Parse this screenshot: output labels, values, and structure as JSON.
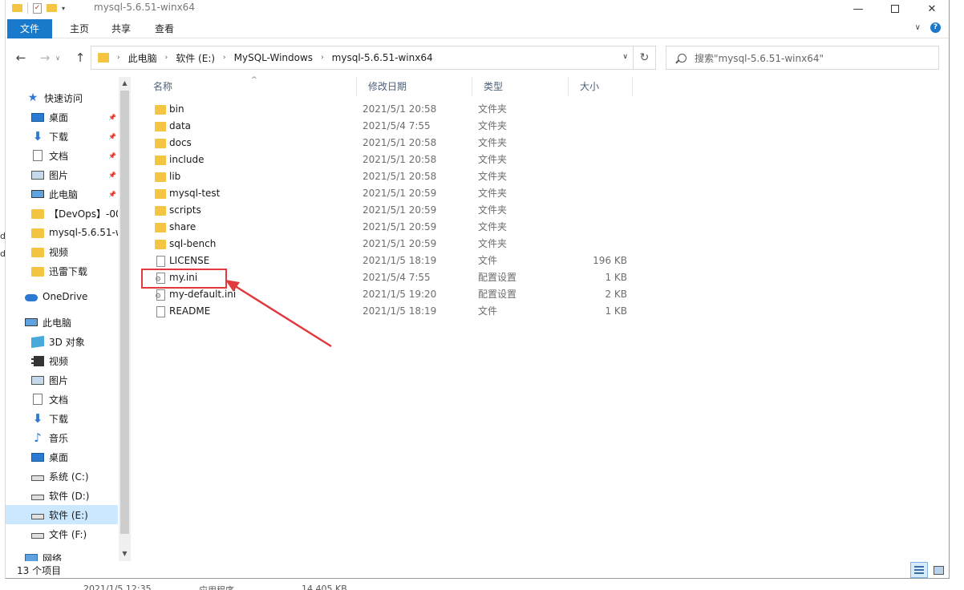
{
  "window": {
    "title": "mysql-5.6.51-winx64",
    "min_label": "—",
    "max_label": "",
    "close_label": "✕"
  },
  "ribbon": {
    "tabs": [
      "文件",
      "主页",
      "共享",
      "查看"
    ],
    "help_label": "?"
  },
  "address": {
    "crumbs": [
      "此电脑",
      "软件 (E:)",
      "MySQL-Windows",
      "mysql-5.6.51-winx64"
    ],
    "search_placeholder": "搜索\"mysql-5.6.51-winx64\""
  },
  "nav_pane": {
    "items": [
      {
        "label": "快速访问",
        "icon": "star-icon",
        "pinned": false
      },
      {
        "label": "桌面",
        "icon": "desktop-icon",
        "pinned": true
      },
      {
        "label": "下载",
        "icon": "download-icon",
        "pinned": true
      },
      {
        "label": "文档",
        "icon": "document-icon",
        "pinned": true
      },
      {
        "label": "图片",
        "icon": "picture-icon",
        "pinned": true
      },
      {
        "label": "此电脑",
        "icon": "computer-icon",
        "pinned": true
      },
      {
        "label": "【DevOps】-00",
        "icon": "folder-icon",
        "pinned": false
      },
      {
        "label": "mysql-5.6.51-w",
        "icon": "folder-icon",
        "pinned": false
      },
      {
        "label": "视频",
        "icon": "folder-icon",
        "pinned": false
      },
      {
        "label": "迅雷下载",
        "icon": "folder-icon",
        "pinned": false
      },
      {
        "label": "OneDrive",
        "icon": "cloud-icon",
        "pinned": false
      },
      {
        "label": "此电脑",
        "icon": "computer-icon",
        "pinned": false
      },
      {
        "label": "3D 对象",
        "icon": "3d-objects-icon",
        "pinned": false
      },
      {
        "label": "视频",
        "icon": "video-icon",
        "pinned": false
      },
      {
        "label": "图片",
        "icon": "picture-icon",
        "pinned": false
      },
      {
        "label": "文档",
        "icon": "document-icon",
        "pinned": false
      },
      {
        "label": "下载",
        "icon": "download-icon",
        "pinned": false
      },
      {
        "label": "音乐",
        "icon": "music-icon",
        "pinned": false
      },
      {
        "label": "桌面",
        "icon": "desktop-icon",
        "pinned": false
      },
      {
        "label": "系统 (C:)",
        "icon": "drive-icon",
        "pinned": false
      },
      {
        "label": "软件 (D:)",
        "icon": "drive-icon",
        "pinned": false
      },
      {
        "label": "软件 (E:)",
        "icon": "drive-icon",
        "pinned": false,
        "selected": true
      },
      {
        "label": "文件 (F:)",
        "icon": "drive-icon",
        "pinned": false
      },
      {
        "label": "网络",
        "icon": "network-icon",
        "pinned": false
      }
    ]
  },
  "columns": {
    "name": "名称",
    "date": "修改日期",
    "type": "类型",
    "size": "大小"
  },
  "files": [
    {
      "name": "bin",
      "date": "2021/5/1 20:58",
      "type": "文件夹",
      "size": "",
      "kind": "folder"
    },
    {
      "name": "data",
      "date": "2021/5/4 7:55",
      "type": "文件夹",
      "size": "",
      "kind": "folder"
    },
    {
      "name": "docs",
      "date": "2021/5/1 20:58",
      "type": "文件夹",
      "size": "",
      "kind": "folder"
    },
    {
      "name": "include",
      "date": "2021/5/1 20:58",
      "type": "文件夹",
      "size": "",
      "kind": "folder"
    },
    {
      "name": "lib",
      "date": "2021/5/1 20:58",
      "type": "文件夹",
      "size": "",
      "kind": "folder"
    },
    {
      "name": "mysql-test",
      "date": "2021/5/1 20:59",
      "type": "文件夹",
      "size": "",
      "kind": "folder"
    },
    {
      "name": "scripts",
      "date": "2021/5/1 20:59",
      "type": "文件夹",
      "size": "",
      "kind": "folder"
    },
    {
      "name": "share",
      "date": "2021/5/1 20:59",
      "type": "文件夹",
      "size": "",
      "kind": "folder"
    },
    {
      "name": "sql-bench",
      "date": "2021/5/1 20:59",
      "type": "文件夹",
      "size": "",
      "kind": "folder"
    },
    {
      "name": "LICENSE",
      "date": "2021/1/5 18:19",
      "type": "文件",
      "size": "196 KB",
      "kind": "file"
    },
    {
      "name": "my.ini",
      "date": "2021/5/4 7:55",
      "type": "配置设置",
      "size": "1 KB",
      "kind": "ini"
    },
    {
      "name": "my-default.ini",
      "date": "2021/1/5 19:20",
      "type": "配置设置",
      "size": "2 KB",
      "kind": "ini"
    },
    {
      "name": "README",
      "date": "2021/1/5 18:19",
      "type": "文件",
      "size": "1 KB",
      "kind": "file"
    }
  ],
  "status": {
    "item_count": "13 个项目"
  },
  "background_strip": {
    "date": "2021/1/5 12:35",
    "type": "应用程序",
    "size": "14,405 KB"
  },
  "annotation": {
    "color": "#e0393e"
  }
}
